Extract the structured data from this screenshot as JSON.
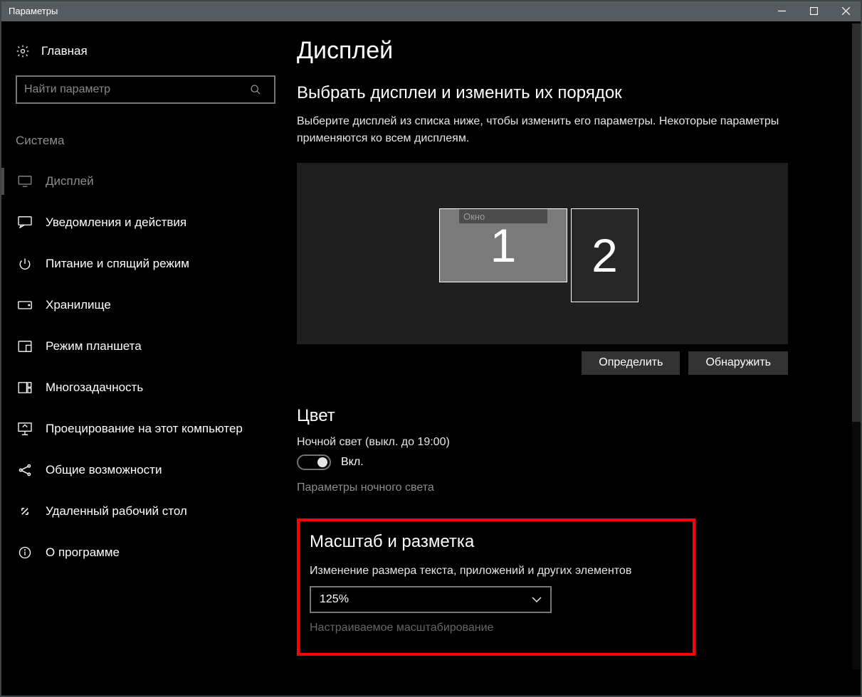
{
  "window": {
    "title": "Параметры"
  },
  "sidebar": {
    "home": "Главная",
    "search_placeholder": "Найти параметр",
    "category": "Система",
    "items": [
      {
        "label": "Дисплей",
        "icon": "monitor"
      },
      {
        "label": "Уведомления и действия",
        "icon": "notification"
      },
      {
        "label": "Питание и спящий режим",
        "icon": "power"
      },
      {
        "label": "Хранилище",
        "icon": "drive"
      },
      {
        "label": "Режим планшета",
        "icon": "tablet"
      },
      {
        "label": "Многозадачность",
        "icon": "multitask"
      },
      {
        "label": "Проецирование на этот компьютер",
        "icon": "project"
      },
      {
        "label": "Общие возможности",
        "icon": "share"
      },
      {
        "label": "Удаленный рабочий стол",
        "icon": "remote"
      },
      {
        "label": "О программе",
        "icon": "info"
      }
    ]
  },
  "main": {
    "title": "Дисплей",
    "select_heading": "Выбрать дисплеи и изменить их порядок",
    "select_desc": "Выберите дисплей из списка ниже, чтобы изменить его параметры. Некоторые параметры применяются ко всем дисплеям.",
    "display1_number": "1",
    "display1_tag": "Окно",
    "display2_number": "2",
    "identify_btn": "Определить",
    "detect_btn": "Обнаружить",
    "color_heading": "Цвет",
    "nightlight_label": "Ночной свет (выкл. до 19:00)",
    "toggle_label": "Вкл.",
    "nightlight_link": "Параметры ночного света",
    "scale_heading": "Масштаб и разметка",
    "scale_desc": "Изменение размера текста, приложений и других элементов",
    "scale_value": "125%",
    "truncated_link": "Настраиваемое масштабирование"
  }
}
